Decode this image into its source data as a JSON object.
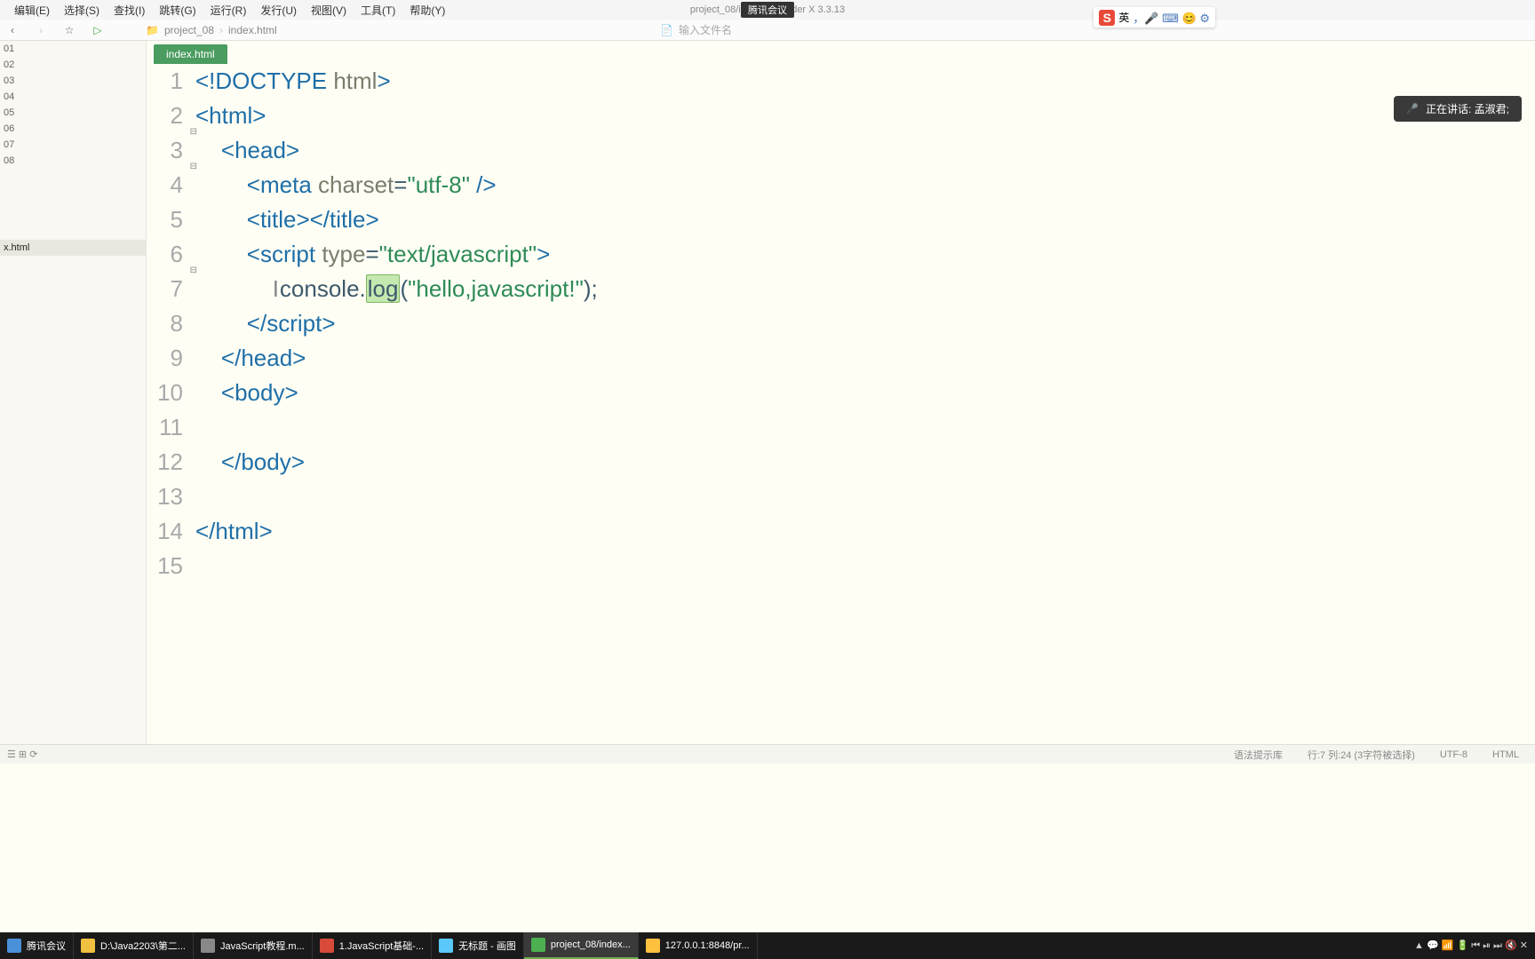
{
  "menubar": {
    "items": [
      "编辑(E)",
      "选择(S)",
      "查找(I)",
      "跳转(G)",
      "运行(R)",
      "发行(U)",
      "视图(V)",
      "工具(T)",
      "帮助(Y)"
    ],
    "title": "project_08/inde... · ...uilder X 3.3.13",
    "overlay": "腾讯会议"
  },
  "toolbar": {
    "breadcrumb": [
      "project_08",
      "index.html"
    ],
    "filename_placeholder": "输入文件名"
  },
  "sidebar": {
    "items": [
      "01",
      "02",
      "03",
      "04",
      "05",
      "06",
      "07",
      "08"
    ],
    "active": "x.html"
  },
  "tab": {
    "label": "index.html"
  },
  "speech": {
    "text": "正在讲话: 孟淑君;"
  },
  "ime": {
    "lang": "英",
    "icons": "，🎤 ⌨ 😊 ⚙"
  },
  "status": {
    "left_icons": "☰  ⊞  ⟳",
    "syntax": "语法提示库",
    "pos": "行:7  列:24 (3字符被选择)",
    "enc": "UTF-8",
    "lang": "HTML"
  },
  "code": {
    "lines": [
      {
        "n": "1",
        "pre": "",
        "t": [
          {
            "txt": "<!DOCTYPE ",
            "c": "tag"
          },
          {
            "txt": "html",
            "c": "attr"
          },
          {
            "txt": ">",
            "c": "tag"
          }
        ]
      },
      {
        "n": "2",
        "pre": "",
        "fold": true,
        "t": [
          {
            "txt": "<html>",
            "c": "tag"
          }
        ]
      },
      {
        "n": "3",
        "pre": "    ",
        "fold": true,
        "t": [
          {
            "txt": "<head>",
            "c": "tag"
          }
        ]
      },
      {
        "n": "4",
        "pre": "        ",
        "t": [
          {
            "txt": "<meta ",
            "c": "tag"
          },
          {
            "txt": "charset",
            "c": "attr"
          },
          {
            "txt": "=",
            "c": "ident"
          },
          {
            "txt": "\"utf-8\"",
            "c": "str"
          },
          {
            "txt": " />",
            "c": "tag"
          }
        ]
      },
      {
        "n": "5",
        "pre": "        ",
        "t": [
          {
            "txt": "<title></title>",
            "c": "tag"
          }
        ]
      },
      {
        "n": "6",
        "pre": "        ",
        "fold": true,
        "t": [
          {
            "txt": "<script ",
            "c": "tag"
          },
          {
            "txt": "type",
            "c": "attr"
          },
          {
            "txt": "=",
            "c": "ident"
          },
          {
            "txt": "\"text/javascript\"",
            "c": "str"
          },
          {
            "txt": ">",
            "c": "tag"
          }
        ]
      },
      {
        "n": "7",
        "pre": "            ",
        "t": [
          {
            "txt": "I",
            "c": "caret"
          },
          {
            "txt": "console",
            "c": "ident"
          },
          {
            "txt": ".",
            "c": "ident"
          },
          {
            "txt": "log",
            "c": "hl"
          },
          {
            "txt": "(",
            "c": "ident"
          },
          {
            "txt": "\"hello,javascript!\"",
            "c": "str"
          },
          {
            "txt": ");",
            "c": "ident"
          }
        ]
      },
      {
        "n": "8",
        "pre": "        ",
        "t": [
          {
            "txt": "</script>",
            "c": "tag"
          }
        ]
      },
      {
        "n": "9",
        "pre": "    ",
        "t": [
          {
            "txt": "</head>",
            "c": "tag"
          }
        ]
      },
      {
        "n": "10",
        "pre": "    ",
        "t": [
          {
            "txt": "<body>",
            "c": "tag"
          }
        ]
      },
      {
        "n": "11",
        "pre": "        ",
        "t": []
      },
      {
        "n": "12",
        "pre": "    ",
        "t": [
          {
            "txt": "</body>",
            "c": "tag"
          }
        ]
      },
      {
        "n": "13",
        "pre": "",
        "t": []
      },
      {
        "n": "14",
        "pre": "",
        "t": [
          {
            "txt": "</html>",
            "c": "tag"
          }
        ]
      },
      {
        "n": "15",
        "pre": "",
        "t": []
      }
    ]
  },
  "taskbar": {
    "items": [
      {
        "label": "腾讯会议",
        "color": "#4a90d9"
      },
      {
        "label": "D:\\Java2203\\第二...",
        "color": "#f0c040"
      },
      {
        "label": "JavaScript教程.m...",
        "color": "#888"
      },
      {
        "label": "1.JavaScript基础-...",
        "color": "#d84a3a"
      },
      {
        "label": "无标题 - 画图",
        "color": "#5ac8fa"
      },
      {
        "label": "project_08/index...",
        "color": "#4caf50",
        "active": true
      },
      {
        "label": "127.0.0.1:8848/pr...",
        "color": "#ffc040"
      }
    ],
    "tray": "▲ 💬 📶 🔋 ⏮ ⏯ ⏭ 🔇 ✕"
  }
}
